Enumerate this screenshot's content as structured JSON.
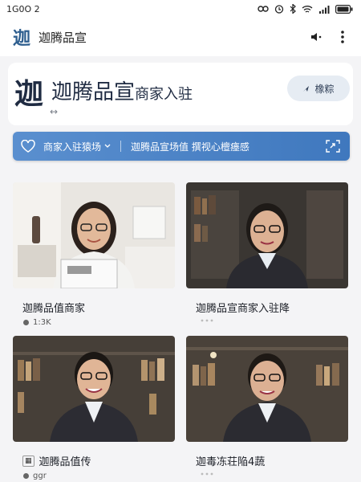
{
  "status_bar": {
    "time": "1G0O 2"
  },
  "app_bar": {
    "logo": "迦",
    "title": "迦腾品宣"
  },
  "brand": {
    "logo": "迦",
    "name": "迦腾品宣",
    "subtitle": "商家入驻",
    "arrow": "↔",
    "search_label": "橡粽"
  },
  "banner": {
    "select_label": "商家入驻猿场",
    "text": "迦腾品宣场值 撰视心檀瘗感"
  },
  "cards": [
    {
      "title": "迦腾品值商家",
      "meta": "1:3K"
    },
    {
      "title": "迦腾品宣商家入驻降",
      "meta": ""
    },
    {
      "title": "迦腾品值传",
      "meta": "ggr"
    },
    {
      "title": "迦毒冻荘陥4蔬",
      "meta": ""
    }
  ],
  "colors": {
    "banner": "#4a82c5",
    "brand_text": "#1f2b42",
    "logo_blue": "#2f5f8f"
  }
}
